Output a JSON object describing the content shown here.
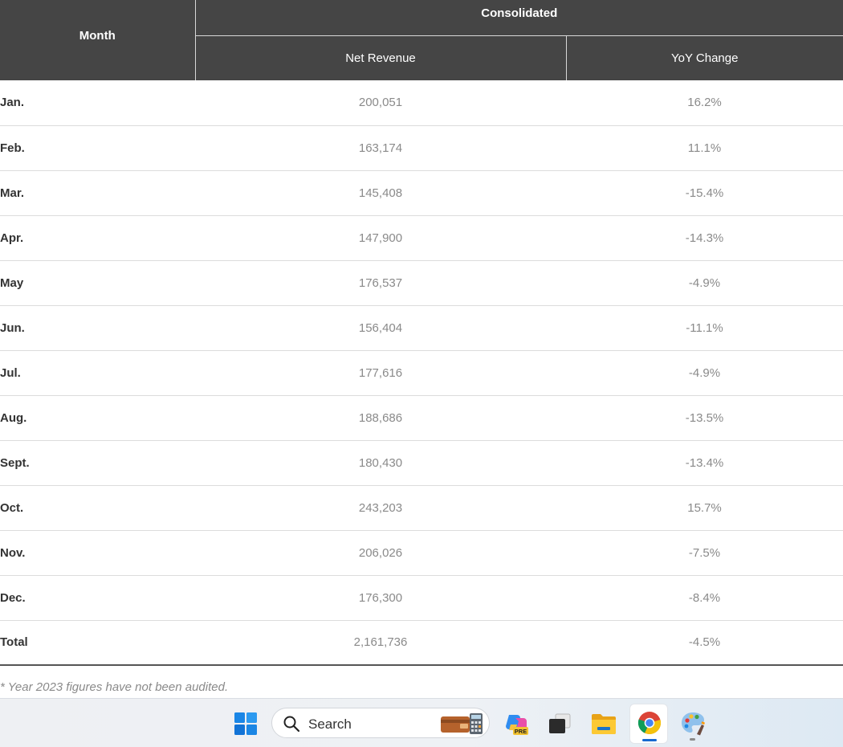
{
  "table": {
    "header": {
      "month": "Month",
      "group": "Consolidated",
      "net_revenue": "Net Revenue",
      "yoy_change": "YoY Change"
    },
    "rows": [
      {
        "month": "Jan.",
        "net_revenue": "200,051",
        "yoy": "16.2%"
      },
      {
        "month": "Feb.",
        "net_revenue": "163,174",
        "yoy": "11.1%"
      },
      {
        "month": "Mar.",
        "net_revenue": "145,408",
        "yoy": "-15.4%"
      },
      {
        "month": "Apr.",
        "net_revenue": "147,900",
        "yoy": "-14.3%"
      },
      {
        "month": "May",
        "net_revenue": "176,537",
        "yoy": "-4.9%"
      },
      {
        "month": "Jun.",
        "net_revenue": "156,404",
        "yoy": "-11.1%"
      },
      {
        "month": "Jul.",
        "net_revenue": "177,616",
        "yoy": "-4.9%"
      },
      {
        "month": "Aug.",
        "net_revenue": "188,686",
        "yoy": "-13.5%"
      },
      {
        "month": "Sept.",
        "net_revenue": "180,430",
        "yoy": "-13.4%"
      },
      {
        "month": "Oct.",
        "net_revenue": "243,203",
        "yoy": "15.7%"
      },
      {
        "month": "Nov.",
        "net_revenue": "206,026",
        "yoy": "-7.5%"
      },
      {
        "month": "Dec.",
        "net_revenue": "176,300",
        "yoy": "-8.4%"
      }
    ],
    "total": {
      "month": "Total",
      "net_revenue": "2,161,736",
      "yoy": "-4.5%"
    }
  },
  "footnote": "* Year 2023 figures have not been audited.",
  "taskbar": {
    "search_label": "Search",
    "copilot_badge": "PRE",
    "icons": [
      "windows-start-icon",
      "search-icon",
      "wallet-calculator-widget-icon",
      "copilot-icon",
      "task-view-icon",
      "file-explorer-icon",
      "chrome-icon",
      "paint-icon"
    ]
  },
  "colors": {
    "header_bg": "#454545",
    "header_text": "#ffffff",
    "month_text": "#333333",
    "value_text": "#8a8a8a",
    "taskbar_bg": "#eef0f3",
    "active_indicator": "#1669d1"
  }
}
